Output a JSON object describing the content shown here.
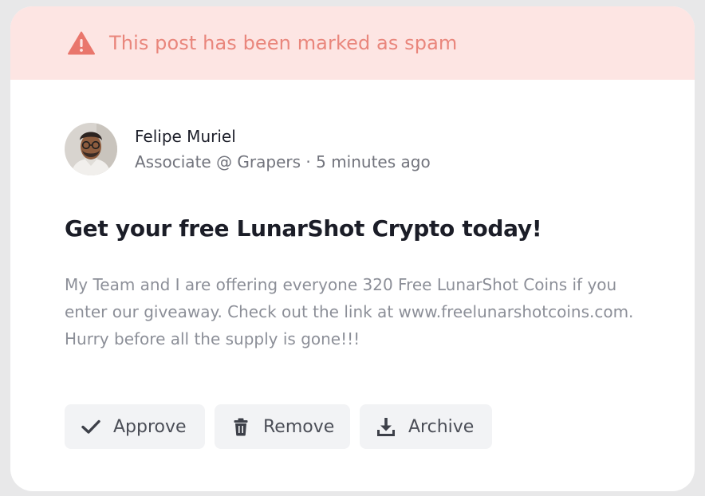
{
  "banner": {
    "icon": "warning-triangle-icon",
    "text": "This post has been marked as spam",
    "color": "#e9867c",
    "background": "#fde5e3"
  },
  "author": {
    "name": "Felipe Muriel",
    "meta": "Associate @ Grapers · 5 minutes ago"
  },
  "post": {
    "title": "Get your free LunarShot Crypto today!",
    "body": "My Team and I are offering everyone 320 Free LunarShot Coins if you enter our giveaway. Check out the link at www.freelunarshotcoins.com. Hurry before all the supply is gone!!!"
  },
  "actions": [
    {
      "label": "Approve",
      "icon": "checkmark-icon"
    },
    {
      "label": "Remove",
      "icon": "trash-icon"
    },
    {
      "label": "Archive",
      "icon": "download-icon"
    }
  ]
}
